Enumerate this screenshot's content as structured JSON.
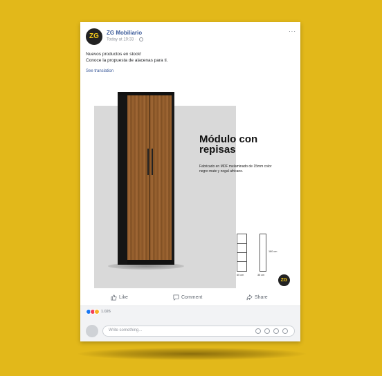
{
  "post": {
    "page_name": "ZG Mobiliario",
    "avatar_text": "ZG",
    "meta": "Today at 19:33 · ",
    "more": "···",
    "text_line1": "Nuevos productos en stock!",
    "text_line2": "Conoce la propuesta de alacenas para ti.",
    "see_translation": "See translation"
  },
  "image": {
    "title_line1": "Módulo con",
    "title_line2": "repisas",
    "description": "Fabricado en MDF melaminado de 15mm color negro mate y nogal africano.",
    "dim_width": "60 cm",
    "dim_depth": "35 cm",
    "dim_height": "180 cm",
    "logo_text": "ZG"
  },
  "actions": {
    "like": "Like",
    "comment": "Comment",
    "share": "Share"
  },
  "reactions": {
    "count": "1.026",
    "colors": [
      "#1877f2",
      "#f33e58",
      "#f7b125"
    ]
  },
  "composer": {
    "placeholder": "Write something..."
  }
}
